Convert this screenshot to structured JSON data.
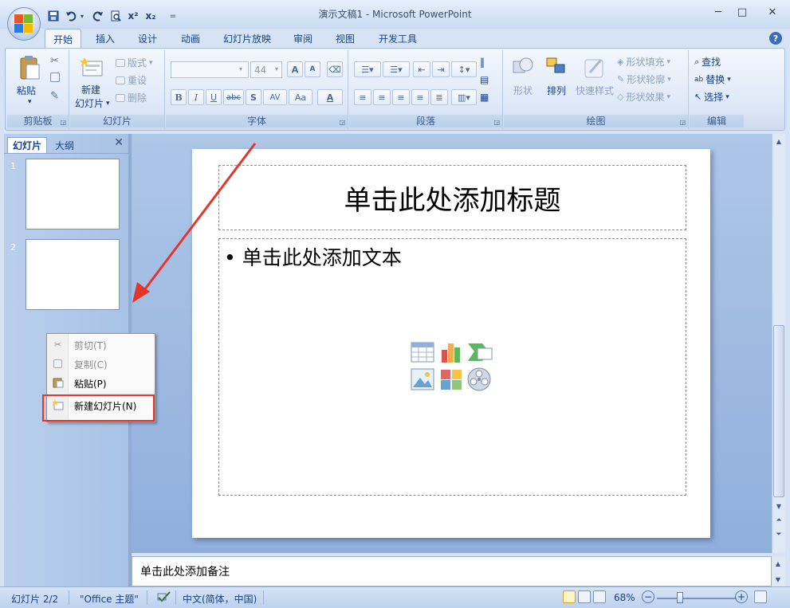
{
  "window": {
    "title": "演示文稿1 - Microsoft PowerPoint",
    "minimize": "─",
    "restore": "□",
    "close": "✕"
  },
  "qat": {
    "customize": "="
  },
  "tabs": [
    {
      "label": "开始",
      "active": true
    },
    {
      "label": "插入"
    },
    {
      "label": "设计"
    },
    {
      "label": "动画"
    },
    {
      "label": "幻灯片放映"
    },
    {
      "label": "审阅"
    },
    {
      "label": "视图"
    },
    {
      "label": "开发工具"
    }
  ],
  "help": "?",
  "ribbon": {
    "clipboard": {
      "label": "剪贴板",
      "paste": "粘贴"
    },
    "slides": {
      "label": "幻灯片",
      "new_slide_1": "新建",
      "new_slide_2": "幻灯片",
      "layout": "版式",
      "reset": "重设",
      "delete": "删除"
    },
    "font": {
      "label": "字体",
      "font_name": "",
      "font_size": "44",
      "bold": "B",
      "italic": "I",
      "underline": "U",
      "strike": "abc",
      "shadow": "S",
      "spacing": "AV",
      "case": "Aa",
      "color": "A",
      "grow": "A",
      "shrink": "A"
    },
    "paragraph": {
      "label": "段落"
    },
    "drawing": {
      "label": "绘图",
      "shapes": "形状",
      "arrange": "排列",
      "quick_styles": "快速样式",
      "fill": "形状填充",
      "outline": "形状轮廓",
      "effects": "形状效果"
    },
    "editing": {
      "label": "编辑",
      "find": "查找",
      "replace": "替换",
      "select": "选择"
    }
  },
  "left_pane": {
    "tab_slides": "幻灯片",
    "tab_outline": "大纲",
    "close": "✕",
    "thumbs": [
      {
        "num": "1"
      },
      {
        "num": "2"
      }
    ]
  },
  "slide": {
    "title_placeholder": "单击此处添加标题",
    "body_placeholder": "单击此处添加文本",
    "bullet": "•"
  },
  "notes": {
    "placeholder": "单击此处添加备注"
  },
  "context_menu": [
    {
      "label": "剪切(T)",
      "icon": "scissors-icon",
      "enabled": false
    },
    {
      "label": "复制(C)",
      "icon": "copy-icon",
      "enabled": false
    },
    {
      "label": "粘贴(P)",
      "icon": "paste-icon",
      "enabled": true
    },
    {
      "label": "新建幻灯片(N)",
      "icon": "new-slide-icon",
      "enabled": true,
      "highlighted": true
    }
  ],
  "status": {
    "slide": "幻灯片 2/2",
    "theme": "\"Office 主题\"",
    "lang": "中文(简体，中国)",
    "zoom": "68%"
  },
  "colors": {
    "accent_red": "#e5352b",
    "ribbon_text": "#15428b"
  }
}
